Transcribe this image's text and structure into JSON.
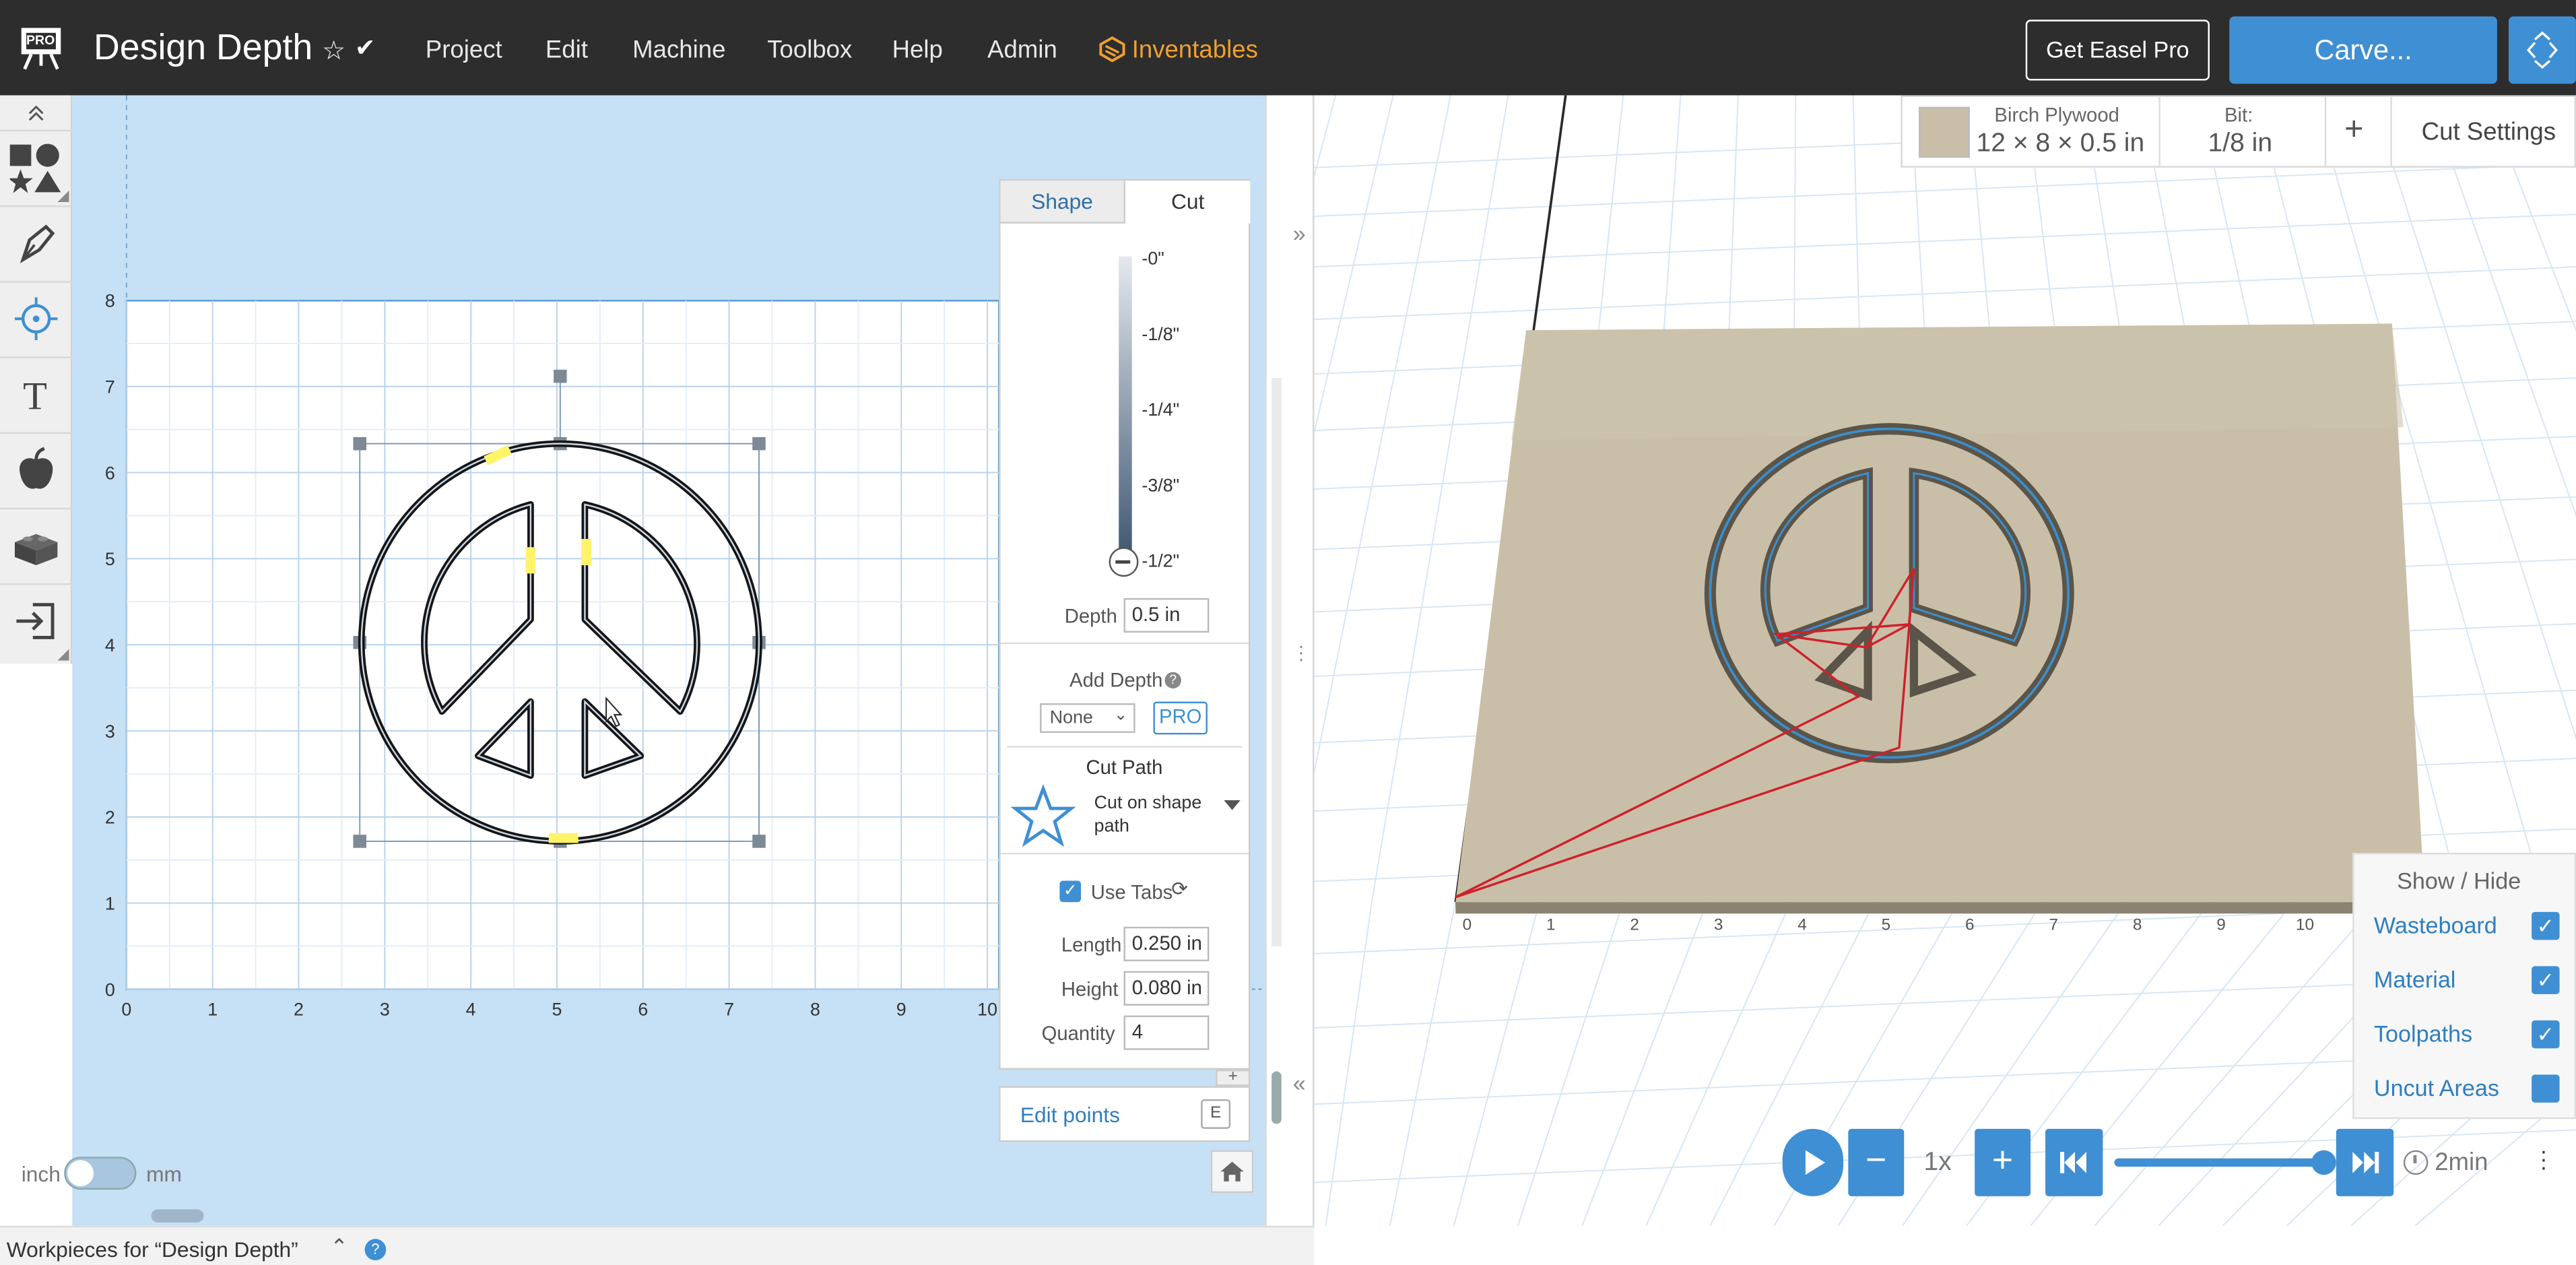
{
  "app": {
    "logo_text": "PRO",
    "title": "Design Depth",
    "menu": [
      "Project",
      "Edit",
      "Machine",
      "Toolbox",
      "Help",
      "Admin",
      "Inventables"
    ],
    "get_pro_label": "Get Easel Pro",
    "carve_label": "Carve..."
  },
  "colors": {
    "accent": "#3f8fd4",
    "topbar": "#2d2d2d",
    "canvas_bg": "#c6e0f5",
    "inventables": "#f0a030",
    "toolpath_red": "#d0202c",
    "tab_yellow": "#fff36a"
  },
  "tools": [
    "shapes-icon",
    "pen-icon",
    "target-icon",
    "text-icon",
    "apple-icon",
    "lego-icon",
    "import-icon"
  ],
  "canvas": {
    "x_ticks": [
      "0",
      "1",
      "2",
      "3",
      "4",
      "5",
      "6",
      "7",
      "8",
      "9",
      "10"
    ],
    "y_ticks": [
      "0",
      "1",
      "2",
      "3",
      "4",
      "5",
      "6",
      "7",
      "8"
    ],
    "unit_left": "inch",
    "unit_right": "mm"
  },
  "inspector": {
    "tabs": [
      "Shape",
      "Cut"
    ],
    "active_tab": "Cut",
    "depth_ticks": [
      "-0\"",
      "-1/8\"",
      "-1/4\"",
      "-3/8\"",
      "-1/2\""
    ],
    "depth_label": "Depth",
    "depth_value": "0.5 in",
    "add_depth_label": "Add Depth",
    "add_depth_value": "None",
    "pro_badge": "PRO",
    "cut_path_label": "Cut Path",
    "cut_path_line1": "Cut on shape",
    "cut_path_line2": "path",
    "use_tabs_label": "Use Tabs",
    "use_tabs_checked": true,
    "length_label": "Length",
    "length_value": "0.250 in",
    "height_label": "Height",
    "height_value": "0.080 in",
    "quantity_label": "Quantity",
    "quantity_value": "4",
    "edit_points_label": "Edit points",
    "edit_points_key": "E"
  },
  "material": {
    "name": "Birch Plywood",
    "dims": "12 × 8 × 0.5 in",
    "bit_label": "Bit:",
    "bit_value": "1/8 in",
    "cut_settings_label": "Cut Settings",
    "add_label": "+"
  },
  "view3d": {
    "x_ticks": [
      "0",
      "1",
      "2",
      "3",
      "4",
      "5",
      "6",
      "7",
      "8",
      "9",
      "10"
    ],
    "show_hide_title": "Show / Hide",
    "show_hide_items": [
      {
        "label": "Wasteboard",
        "checked": true
      },
      {
        "label": "Material",
        "checked": true
      },
      {
        "label": "Toolpaths",
        "checked": true
      },
      {
        "label": "Uncut Areas",
        "checked": false
      }
    ],
    "speed_label": "1x",
    "time_label": "2min",
    "progress": 1.0
  },
  "footer": {
    "workpieces_label": "Workpieces for “Design Depth”"
  }
}
